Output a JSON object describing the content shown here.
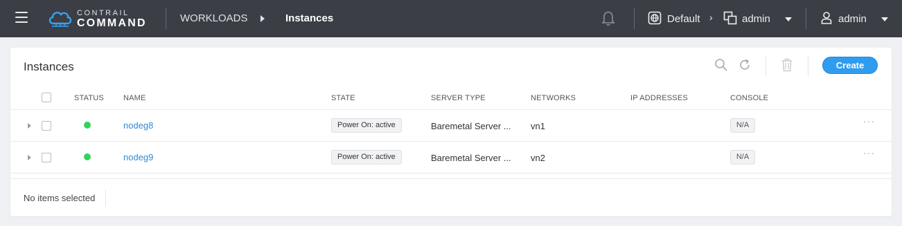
{
  "topbar": {
    "logo_top": "CONTRAIL",
    "logo_bottom": "COMMAND",
    "breadcrumb": [
      "WORKLOADS",
      "Instances"
    ],
    "domain": "Default",
    "project": "admin",
    "user": "admin"
  },
  "page": {
    "title": "Instances",
    "create_label": "Create",
    "selection_status": "No items selected"
  },
  "table": {
    "columns": [
      "STATUS",
      "NAME",
      "STATE",
      "SERVER TYPE",
      "NETWORKS",
      "IP ADDRESSES",
      "CONSOLE"
    ],
    "rows": [
      {
        "status": "active",
        "name": "nodeg8",
        "state": "Power On: active",
        "server_type": "Baremetal Server ...",
        "networks": "vn1",
        "ip_addresses": "",
        "console": "N/A"
      },
      {
        "status": "active",
        "name": "nodeg9",
        "state": "Power On: active",
        "server_type": "Baremetal Server ...",
        "networks": "vn2",
        "ip_addresses": "",
        "console": "N/A"
      }
    ]
  },
  "colors": {
    "topbar": "#3b3f45",
    "accent": "#2f9cf0",
    "link": "#2f8ad8",
    "status_active": "#2fd45a"
  },
  "icons": [
    "menu-icon",
    "contrail-logo-icon",
    "caret-right-icon",
    "bell-icon",
    "globe-icon",
    "chevron-right-icon",
    "project-icon",
    "caret-down-icon",
    "user-icon",
    "search-icon",
    "refresh-icon",
    "trash-icon",
    "more-icon"
  ]
}
